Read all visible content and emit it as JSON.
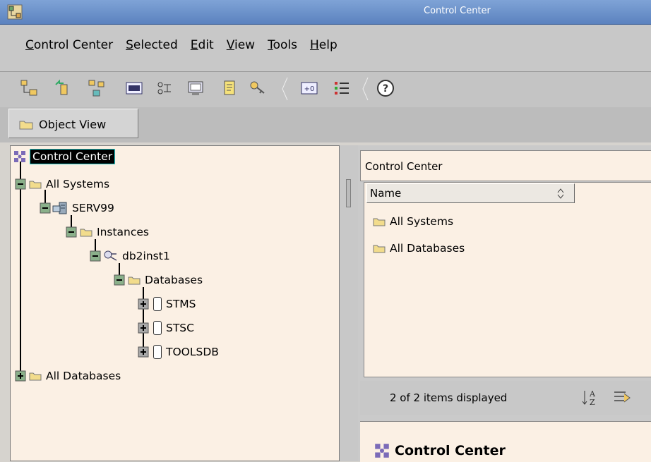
{
  "window": {
    "title": "Control Center"
  },
  "menu": [
    "Control Center",
    "Selected",
    "Edit",
    "View",
    "Tools",
    "Help"
  ],
  "toolbar_icons": [
    "object-tree-icon",
    "replication-icon",
    "satellite-icon",
    "command-editor-icon",
    "task-center-icon",
    "journal-icon",
    "license-icon",
    "key-icon",
    "tools-settings-icon",
    "list-view-icon",
    "help-icon"
  ],
  "view_tab": {
    "label": "Object View"
  },
  "tree": {
    "root": "Control Center",
    "nodes": [
      {
        "label": "All Systems"
      },
      {
        "label": "SERV99"
      },
      {
        "label": "Instances"
      },
      {
        "label": "db2inst1"
      },
      {
        "label": "Databases"
      },
      {
        "label": "STMS"
      },
      {
        "label": "STSC"
      },
      {
        "label": "TOOLSDB"
      },
      {
        "label": "All Databases"
      }
    ]
  },
  "contents": {
    "header": "Control Center",
    "column": "Name",
    "items": [
      "All Systems",
      "All Databases"
    ],
    "status": "2 of 2 items displayed"
  },
  "details": {
    "title": "Control Center"
  },
  "colors": {
    "title_bar": "#5b82bf",
    "panel_bg": "#fbf0e4",
    "chrome": "#d6d3ce"
  }
}
